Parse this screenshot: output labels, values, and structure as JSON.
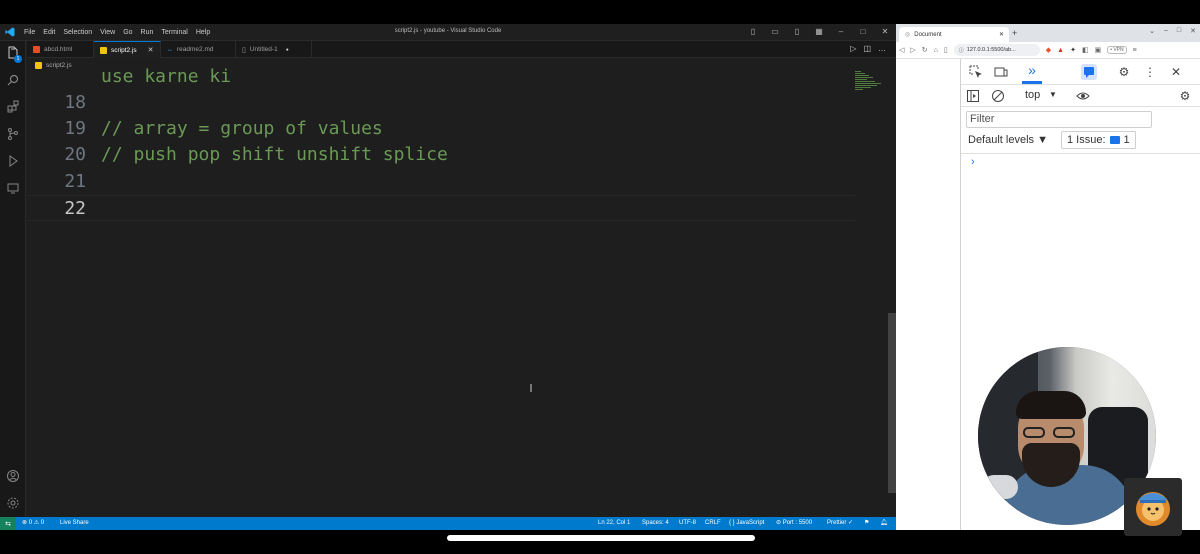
{
  "vscode": {
    "menu": [
      "File",
      "Edit",
      "Selection",
      "View",
      "Go",
      "Run",
      "Terminal",
      "Help"
    ],
    "window_title": "script2.js - youtube - Visual Studio Code",
    "tabs": [
      {
        "label": "abcd.html",
        "icon": "html-file-icon",
        "color": "#e44d26"
      },
      {
        "label": "script2.js",
        "icon": "js-file-icon",
        "color": "#f1c40f",
        "close": "✕"
      },
      {
        "label": "readme2.md",
        "icon": "markdown-file-icon",
        "color": "#42a5f5"
      },
      {
        "label": "Untitled-1",
        "icon": "file-icon",
        "color": "#9d9d9d",
        "dot": "●"
      }
    ],
    "breadcrumb": "script2.js",
    "editor": {
      "lines": [
        {
          "number": "",
          "text": "use karne ki"
        },
        {
          "number": "18",
          "text": ""
        },
        {
          "number": "19",
          "text": "// array = group of values"
        },
        {
          "number": "20",
          "text": "// push pop shift unshift splice"
        },
        {
          "number": "21",
          "text": ""
        },
        {
          "number": "22",
          "text": ""
        }
      ]
    },
    "activity_badge": "1",
    "status": {
      "problems": "⊗ 0 ⚠ 0",
      "live_share": "Live Share",
      "position": "Ln 22, Col 1",
      "spaces": "Spaces: 4",
      "encoding": "UTF-8",
      "eol": "CRLF",
      "language": "{ } JavaScript",
      "port": "⊘ Port : 5500",
      "prettier": "Prettier ✓"
    },
    "colors": {
      "accent": "#007acc",
      "comment": "#6a9955",
      "remote": "#16825d"
    }
  },
  "browser": {
    "tab_title": "Document",
    "url": "127.0.0.1:5500/ab...",
    "vpn": "• VPN",
    "devtools": {
      "context": "top",
      "filter_placeholder": "Filter",
      "levels": "Default levels ▼",
      "issues_prefix": "1 Issue:",
      "issues_count": "1",
      "prompt": "›"
    }
  }
}
